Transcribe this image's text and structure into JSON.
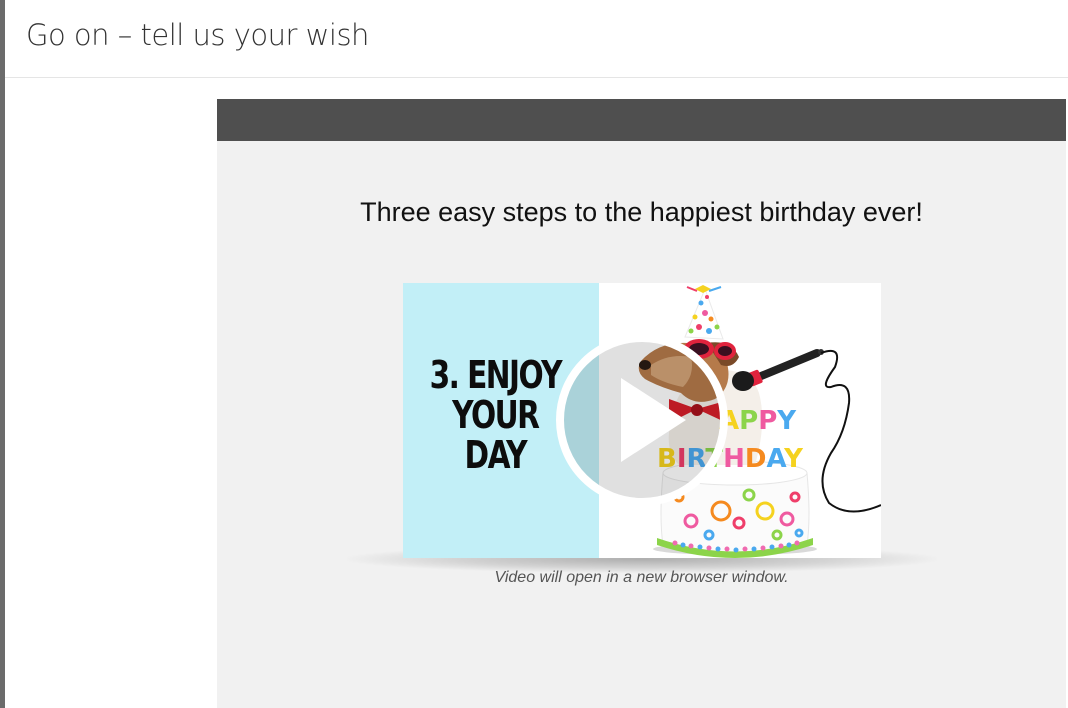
{
  "modal": {
    "title": "Go on – tell us your wish"
  },
  "panel": {
    "headline": "Three easy steps to the happiest birthday ever!",
    "video": {
      "step_lines": [
        "3. ENJOY",
        "YOUR",
        "DAY"
      ],
      "greeting_line_1": "HAPPY",
      "greeting_line_2": "BIRTHDAY",
      "play_icon": "play-icon"
    },
    "caption": "Video will open in a new browser window."
  },
  "colors": {
    "thumb_left_bg": "#c2eff7",
    "panel_bar": "#4f4f4f",
    "panel_bg": "#f1f1f1"
  }
}
